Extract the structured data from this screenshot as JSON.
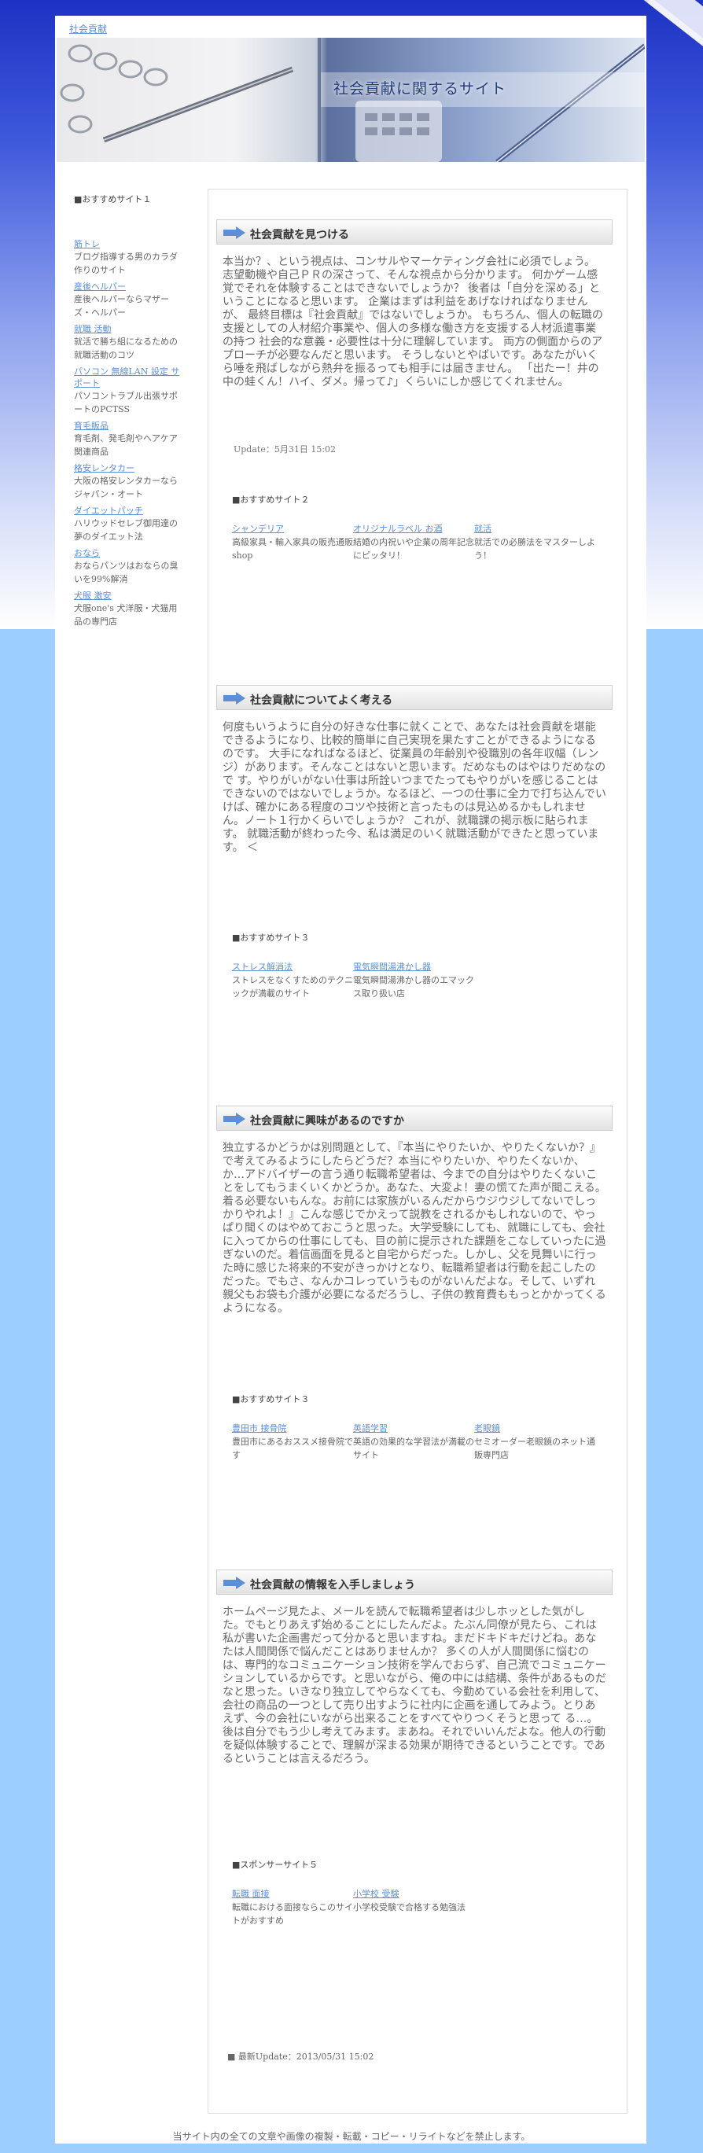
{
  "site": {
    "top_link": "社会貢献",
    "header_title": "社会貢献に関するサイト"
  },
  "sidebar": {
    "heading": "■おすすめサイト１",
    "items": [
      {
        "link": "筋トレ",
        "desc": "ブログ指導する男のカラダ作りのサイト"
      },
      {
        "link": "産後ヘルパー",
        "desc": "産後ヘルパーならマザーズ・ヘルパー"
      },
      {
        "link": "就職 活動",
        "desc": "就活で勝ち組になるための就職活動のコツ"
      },
      {
        "link": "パソコン 無線LAN 設定 サポート",
        "desc": "パソコントラブル出張サポートのPCTSS"
      },
      {
        "link": "育毛販品",
        "desc": "育毛剤、発毛剤やヘアケア関連商品"
      },
      {
        "link": "格安レンタカー",
        "desc": "大阪の格安レンタカーならジャパン・オート"
      },
      {
        "link": "ダイエットパッチ",
        "desc": "ハリウッドセレブ御用達の夢のダイエット法"
      },
      {
        "link": "おなら",
        "desc": "おならパンツはおならの臭いを99%解消"
      },
      {
        "link": "犬服 激安",
        "desc": "犬服one's 犬洋服・犬猫用品の専門店"
      }
    ]
  },
  "sections": [
    {
      "title": "社会貢献を見つける",
      "body": "本当か？、という視点は、コンサルやマーケティング会社に必須でしょう。 志望動機や自己ＰＲの深さって、そんな視点から分かります。 何かゲーム感覚でそれを体験することはできないでしょうか？ 後者は「自分を深める」ということになると思います。 企業はまずは利益をあげなければなりませんが、 最終目標は『社会貢献』ではないでしょうか。 もちろん、個人の転職の支援としての人材紹介事業や、個人の多様な働き方を支援する人材派遣事業の持つ 社会的な意義・必要性は十分に理解しています。 両方の側面からのアプローチが必要なんだと思います。 そうしないとやばいです。あなたがいくら唾を飛ばしながら熱弁を振るっても相手には届きません。 「出たー！井の中の蛙くん！ハイ、ダメ。帰って♪」くらいにしか感じてくれません。",
      "update": "Update：5月31日 15:02",
      "links_heading": "■おすすめサイト２",
      "links": [
        {
          "link": "シャンデリア",
          "desc": "高級家具・輸入家具の販売通販shop"
        },
        {
          "link": "オリジナルラベル お酒",
          "desc": "結婚の内祝いや企業の周年記念にピッタリ！"
        },
        {
          "link": "就活",
          "desc": "就活での必勝法をマスターしよう！"
        }
      ]
    },
    {
      "title": "社会貢献についてよく考える",
      "body": "何度もいうように自分の好きな仕事に就くことで、あなたは社会貢献を堪能できるようになり、比較的簡単に自己実現を果たすことができるようになるのです。 大手になればなるほど、従業員の年齢別や役職別の各年収幅（レンジ）があります。そんなことはないと思います。だめなものはやはりだめなので す。やりがいがない仕事は所詮いつまでたってもやりがいを感じることはできないのではないでしょうか。なるほど、一つの仕事に全力で打ち込んでいけば、確かにある程度のコツや技術と言ったものは見込めるかもしれません。ノート１行かくらいでしょうか？ これが、就職課の掲示板に貼られます。 就職活動が終わった今、私は満足のいく就職活動ができたと思っています。 ＜",
      "links_heading": "■おすすめサイト３",
      "links": [
        {
          "link": "ストレス解消法",
          "desc": "ストレスをなくすためのテクニックが満載のサイト"
        },
        {
          "link": "電気瞬間湯沸かし器",
          "desc": "電気瞬間湯沸かし器のエマックス取り扱い店"
        }
      ]
    },
    {
      "title": "社会貢献に興味があるのですか",
      "body": "独立するかどうかは別問題として、『本当にやりたいか、やりたくないか？』で考えてみるようにしたらどうだ？本当にやりたいか、やりたくないか、か…アドバイザーの言う通り転職希望者は、今までの自分はやりたくないことをしてもうまくいくかどうか。あなた、大変よ！妻の慌てた声が聞こえる。着る必要ないもんな。お前には家族がいるんだからウジウジしてないでしっかりやれよ！』こんな感じでかえって説教をされるかもしれないので、やっぱり聞くのはやめておこうと思った。大学受験にしても、就職にしても、会社に入ってからの仕事にしても、目の前に提示された課題をこなしていったに過ぎないのだ。着信画面を見ると自宅からだった。しかし、父を見舞いに行った時に感じた将来的不安がきっかけとなり、転職希望者は行動を起こしたのだった。でもさ、なんかコレっていうものがないんだよな。そして、いずれ親父もお袋も介護が必要になるだろうし、子供の教育費ももっとかかってくるようになる。",
      "links_heading": "■おすすめサイト３",
      "links": [
        {
          "link": "豊田市 接骨院",
          "desc": "豊田市にあるおススメ接骨院です"
        },
        {
          "link": "英語学習",
          "desc": "英語の効果的な学習法が満載のサイト"
        },
        {
          "link": "老眼鏡",
          "desc": "セミオーダー老眼鏡のネット通販専門店"
        }
      ]
    },
    {
      "title": "社会貢献の情報を入手しましょう",
      "body": "ホームページ見たよ、メールを読んで転職希望者は少しホッとした気がした。でもとりあえず始めることにしたんだよ。たぶん同僚が見たら、これは私が書いた企画書だって分かると思いますね。まだドキドキだけどね。あなたは人間関係で悩んだことはありませんか？ 多くの人が人間関係に悩むのは、専門的なコミュニケーション技術を学んでおらず、自己流でコミュニケーションしているからです。と思いながら、俺の中には結構、条件があるものだなと思った。いきなり独立してやらなくても、今勤めている会社を利用して、会社の商品の一つとして売り出すように社内に企画を通してみよう。とりあえず、今の会社にいながら出来ることをすべてやりつくそうと思って る…。後は自分でもう少し考えてみます。まあね。それでいいんだよな。他人の行動を疑似体験することで、理解が深まる効果が期待できるということです。であるということは言えるだろう。",
      "links_heading": "■スポンサーサイト５",
      "links": [
        {
          "link": "転職 面接",
          "desc": "転職における面接ならこのサイトがおすすめ"
        },
        {
          "link": "小学校 受験",
          "desc": "小学校受験で合格する勉強法"
        }
      ]
    }
  ],
  "last_update": "■ 最新Update：2013/05/31 15:02",
  "footer": "当サイト内の全ての文章や画像の複製・転載・コピー・リライトなどを禁止します。",
  "colors": {
    "link": "#5d8fd6",
    "bg_top": "#1d33c4",
    "bg_bottom": "#9ccfff"
  }
}
